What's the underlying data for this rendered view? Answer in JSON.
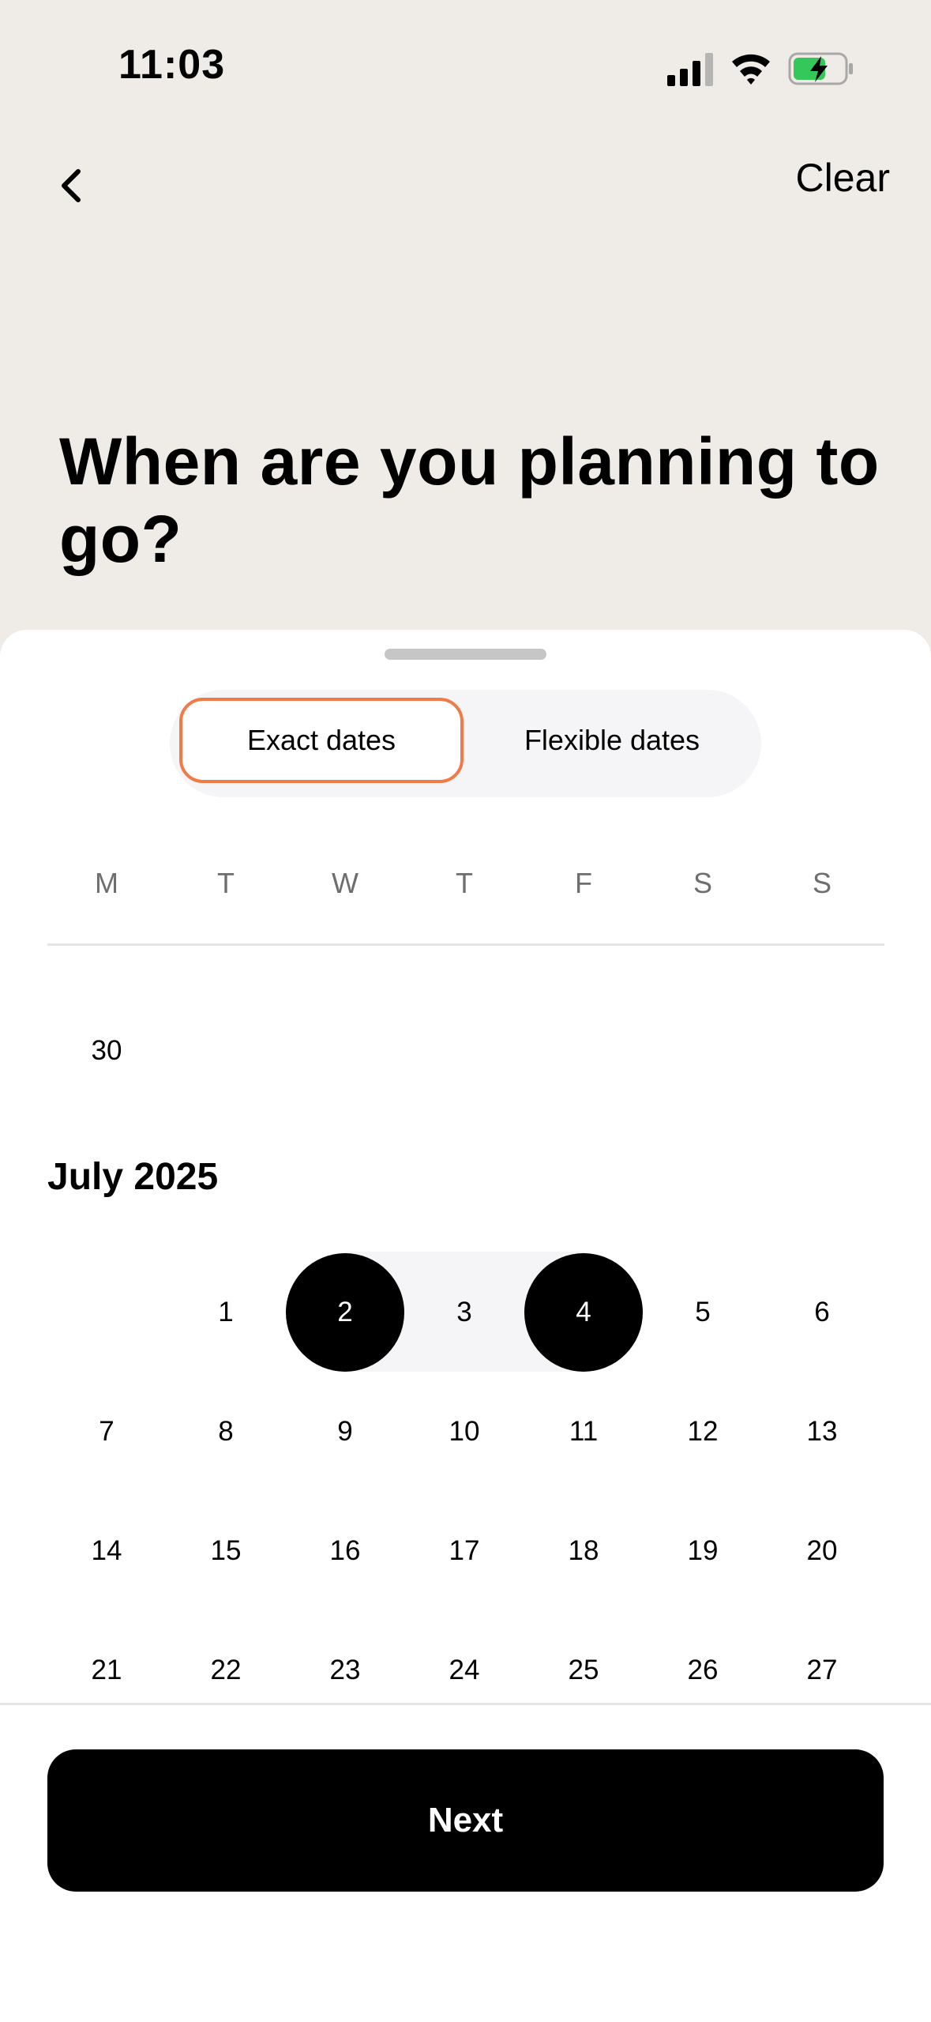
{
  "status_bar": {
    "time": "11:03",
    "battery_color": "#34C759"
  },
  "nav": {
    "back_icon": "chevron-left-icon",
    "clear_label": "Clear"
  },
  "title": "When are you planning to go?",
  "date_mode": {
    "options": [
      "Exact dates",
      "Flexible dates"
    ],
    "selected": "Exact dates",
    "accent_color": "#F07A48"
  },
  "weekdays": [
    "M",
    "T",
    "W",
    "T",
    "F",
    "S",
    "S"
  ],
  "prev_month_tail": [
    "30"
  ],
  "month": {
    "title": "July 2025",
    "rows": [
      [
        "",
        "1",
        "2",
        "3",
        "4",
        "5",
        "6"
      ],
      [
        "7",
        "8",
        "9",
        "10",
        "11",
        "12",
        "13"
      ],
      [
        "14",
        "15",
        "16",
        "17",
        "18",
        "19",
        "20"
      ],
      [
        "21",
        "22",
        "23",
        "24",
        "25",
        "26",
        "27"
      ]
    ],
    "selected_start": "2",
    "selected_end": "4"
  },
  "next_label": "Next"
}
